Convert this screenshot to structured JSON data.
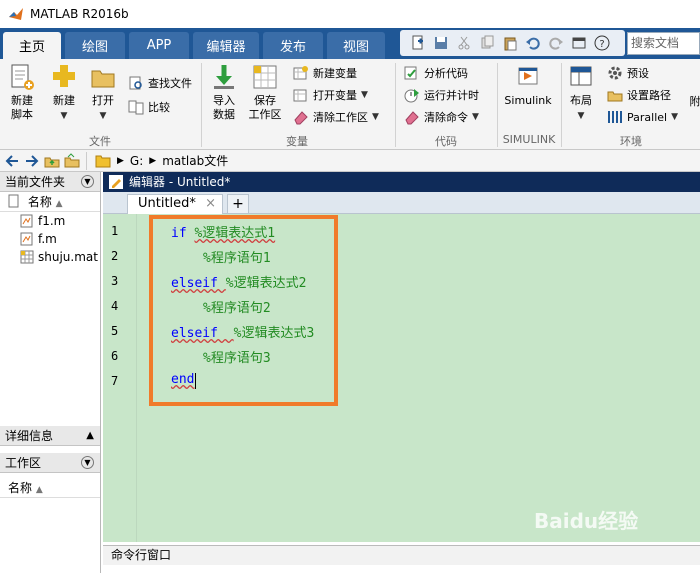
{
  "window": {
    "title": "MATLAB R2016b"
  },
  "tabs": [
    {
      "label": "主页"
    },
    {
      "label": "绘图"
    },
    {
      "label": "APP"
    },
    {
      "label": "编辑器"
    },
    {
      "label": "发布"
    },
    {
      "label": "视图"
    }
  ],
  "search": {
    "placeholder": "搜索文档"
  },
  "ribbon": {
    "file": {
      "new_script": "新建\n脚本",
      "new": "新建",
      "open": "打开",
      "find_files": "查找文件",
      "compare": "比较",
      "group": "文件"
    },
    "variable": {
      "import": "导入\n数据",
      "save_workspace": "保存\n工作区",
      "new_variable": "新建变量",
      "open_variable": "打开变量",
      "clear_workspace": "清除工作区",
      "group": "变量"
    },
    "code": {
      "analyze": "分析代码",
      "run_timing": "运行并计时",
      "clear_commands": "清除命令",
      "group": "代码"
    },
    "simulink": {
      "simulink": "Simulink",
      "group": "SIMULINK"
    },
    "env": {
      "layout": "布局",
      "preferences": "预设",
      "set_path": "设置路径",
      "parallel": "Parallel",
      "addons": "附",
      "group": "环境"
    }
  },
  "address": {
    "drive": "G:",
    "folder": "matlab文件"
  },
  "left": {
    "current_folder_title": "当前文件夹",
    "name_col": "名称",
    "files": [
      "f1.m",
      "f.m",
      "shuju.mat"
    ],
    "details_title": "详细信息",
    "workspace_title": "工作区",
    "workspace_name_col": "名称"
  },
  "editor": {
    "title": "编辑器 - Untitled*",
    "tab": "Untitled*",
    "line_numbers": [
      "1",
      "2",
      "3",
      "4",
      "5",
      "6",
      "7"
    ],
    "lines": [
      {
        "kw": "if ",
        "cm": "%逻辑表达式1"
      },
      {
        "kw": "",
        "cm": "%程序语句1"
      },
      {
        "kw": "elseif ",
        "cm": "%逻辑表达式2"
      },
      {
        "kw": "",
        "cm": "%程序语句2"
      },
      {
        "kw": "elseif  ",
        "cm": "%逻辑表达式3"
      },
      {
        "kw": "",
        "cm": "%程序语句3"
      },
      {
        "kw": "end",
        "cm": ""
      }
    ]
  },
  "command_window": {
    "title": "命令行窗口"
  },
  "watermark": "Baidu经验",
  "colors": {
    "tab_bar": "#1f5796",
    "editor_bg": "#c8e6c9",
    "keyword": "#0000ff",
    "comment": "#228b22",
    "highlight": "#f07b2a"
  }
}
